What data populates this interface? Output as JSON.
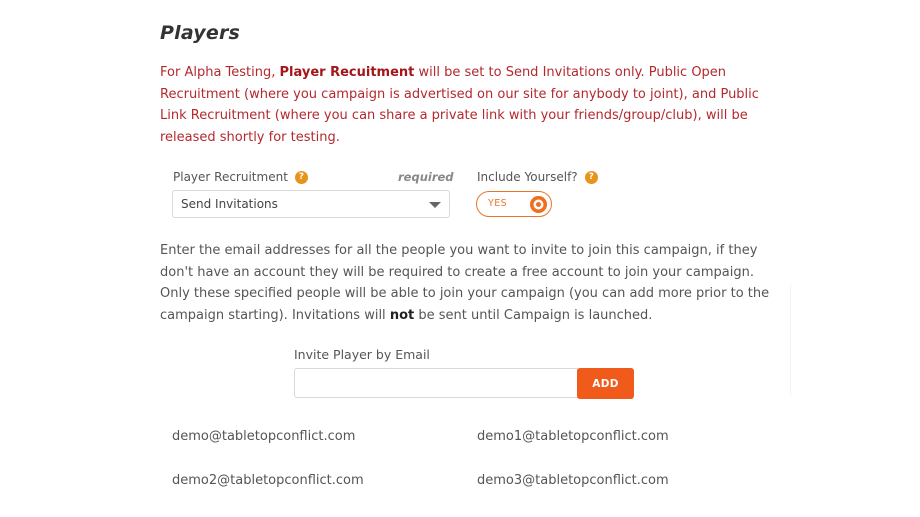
{
  "section": {
    "title": "Players"
  },
  "notice": {
    "prefix": "For Alpha Testing, ",
    "highlight": "Player Recuitment",
    "suffix": " will be set to Send Invitations only. Public Open Recruitment (where you campaign is advertised on our site for anybody to joint), and Public Link Recruitment (where you can share a private link with your friends/group/club), will be released shortly for testing."
  },
  "recruitment": {
    "label": "Player Recruitment",
    "required_label": "required",
    "selected": "Send Invitations",
    "help_icon": "question-circle-icon"
  },
  "include_yourself": {
    "label": "Include Yourself?",
    "toggle_label": "YES",
    "state": "on",
    "help_icon": "question-circle-icon"
  },
  "instructions": {
    "before": "Enter the email addresses for all the people you want to invite to join this campaign, if they don't have an account they will be required to create a free account to join your campaign. Only these specified people will be able to join your campaign (you can add more prior to the campaign starting). Invitations will ",
    "emphasis": "not",
    "after": " be sent until Campaign is launched."
  },
  "invite": {
    "label": "Invite Player by Email",
    "value": "",
    "placeholder": "",
    "add_label": "ADD"
  },
  "invited_emails": [
    "demo@tabletopconflict.com",
    "demo1@tabletopconflict.com",
    "demo2@tabletopconflict.com",
    "demo3@tabletopconflict.com"
  ],
  "colors": {
    "accent_orange": "#f05a1a",
    "notice_red": "#b3292e",
    "help_icon": "#e8931a"
  }
}
